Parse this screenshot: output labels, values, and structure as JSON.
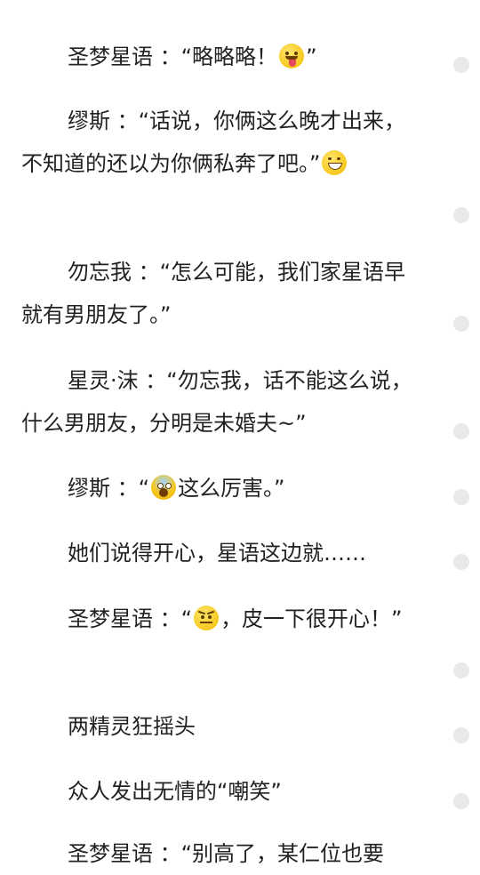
{
  "paragraphs": [
    {
      "text": "圣梦星语 ：“略略略！",
      "after": "”"
    },
    {
      "text": "缪斯 ：“话说，你俩这么晚才出来，不知道的还以为你俩私奔了吧。”"
    },
    {
      "text": "勿忘我 ：“怎么可能，我们家星语早就有男朋友了。”"
    },
    {
      "text": "星灵·沫 ：“勿忘我，话不能这么说，什么男朋友，分明是未婚夫~”"
    },
    {
      "text": "缪斯 ：“",
      "after": "这么厉害。”"
    },
    {
      "text": "她们说得开心，星语这边就……"
    },
    {
      "text": "圣梦星语 ：“",
      "after": "，皮一下很开心！”"
    },
    {
      "text": "两精灵狂摇头"
    },
    {
      "text": "众人发出无情的“嘲笑”"
    },
    {
      "text": "圣梦星语 ：“别高了，某仁位也要"
    }
  ],
  "emojis": {
    "p1": "tongue-emoji",
    "p2": "grin-emoji",
    "p5": "scream-emoji",
    "p7": "angry-emoji"
  }
}
